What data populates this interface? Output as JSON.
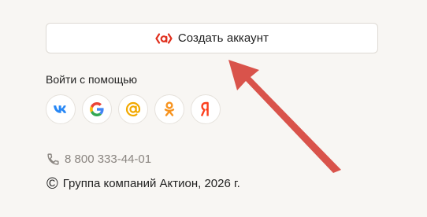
{
  "create_account": {
    "label": "Создать аккаунт",
    "logo": "aktion-a-logo",
    "logo_color": "#e0301e"
  },
  "login_with": {
    "title": "Войти с помощью",
    "providers": [
      {
        "name": "vk",
        "icon": "vk-icon",
        "color": "#2787f5"
      },
      {
        "name": "google",
        "icon": "google-icon",
        "color": "#4285f4"
      },
      {
        "name": "mail",
        "icon": "at-sign-icon",
        "color": "#f2a900"
      },
      {
        "name": "odnoklassniki",
        "icon": "ok-icon",
        "color": "#f7931e"
      },
      {
        "name": "yandex",
        "icon": "yandex-icon",
        "color": "#fc3f1d"
      }
    ]
  },
  "contacts": {
    "phone": "8 800 333-44-01",
    "phone_icon": "phone-icon",
    "copyright_symbol": "©",
    "copyright_text": "Группа компаний Актион, 2026 г."
  },
  "annotation": {
    "arrow_color": "#d9534b"
  }
}
